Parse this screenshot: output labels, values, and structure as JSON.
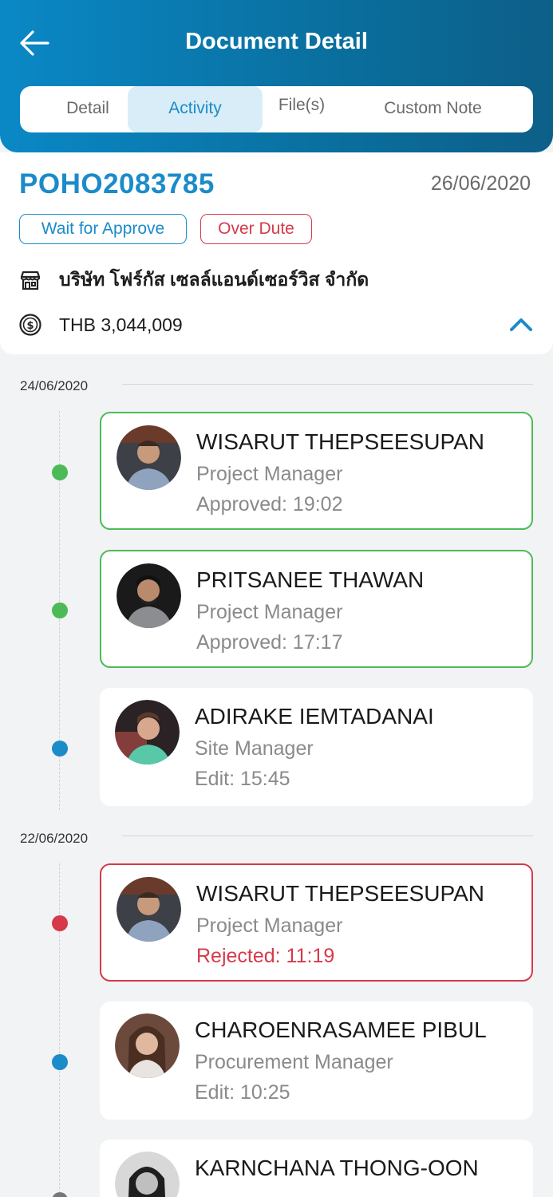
{
  "header": {
    "title": "Document Detail",
    "back_icon": "arrow-left-icon"
  },
  "tabs": [
    {
      "label": "Detail",
      "active": false
    },
    {
      "label": "Activity",
      "active": true
    },
    {
      "label": "File(s)",
      "active": false
    },
    {
      "label": "Custom Note",
      "active": false
    }
  ],
  "document": {
    "number": "POHO2083785",
    "date": "26/06/2020",
    "badges": {
      "status": "Wait for Approve",
      "due": "Over Dute"
    },
    "company": "บริษัท โฟร์กัส เซลล์แอนด์เซอร์วิส จำกัด",
    "amount": "THB 3,044,009",
    "icons": {
      "company": "store-icon",
      "amount": "dollar-coin-icon",
      "collapse": "chevron-up-icon"
    }
  },
  "colors": {
    "primary": "#1b8bc9",
    "approved": "#4cbb57",
    "rejected": "#d63a4a",
    "edit": "#1b8bc9",
    "pending": "#777777"
  },
  "timeline": {
    "groups": [
      {
        "date": "24/06/2020",
        "entries": [
          {
            "name": "WISARUT THEPSEESUPAN",
            "role": "Project Manager",
            "status": "Approved: 19:02",
            "type": "approved"
          },
          {
            "name": "PRITSANEE THAWAN",
            "role": "Project Manager",
            "status": "Approved: 17:17",
            "type": "approved"
          },
          {
            "name": "ADIRAKE IEMTADANAI",
            "role": "Site Manager",
            "status": "Edit: 15:45",
            "type": "edit"
          }
        ]
      },
      {
        "date": "22/06/2020",
        "entries": [
          {
            "name": "WISARUT THEPSEESUPAN",
            "role": "Project Manager",
            "status": "Rejected: 11:19",
            "type": "rejected"
          },
          {
            "name": "CHAROENRASAMEE PIBUL",
            "role": "Procurement Manager",
            "status": "Edit: 10:25",
            "type": "edit"
          },
          {
            "name": "KARNCHANA THONG-OON",
            "role": "",
            "status": "",
            "type": "pending"
          }
        ]
      }
    ]
  }
}
